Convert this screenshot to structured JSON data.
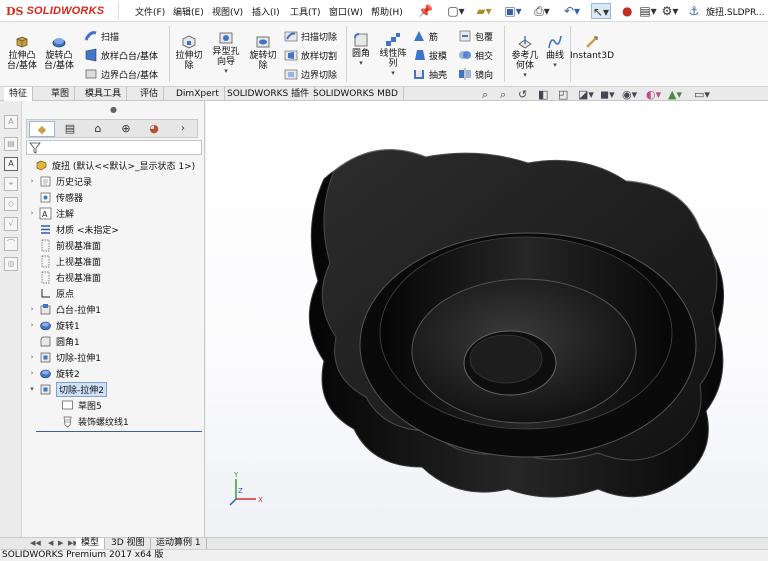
{
  "app": {
    "logo_ds": "DS",
    "logo_brand": "SOLIDWORKS"
  },
  "menu": [
    "文件(F)",
    "编辑(E)",
    "视图(V)",
    "插入(I)",
    "工具(T)",
    "窗口(W)",
    "帮助(H)"
  ],
  "document_title": "旋扭.SLDPR...",
  "command_manager": {
    "buttons": {
      "extrude_boss": "拉伸凸\n台/基体",
      "revolve_boss": "旋转凸\n台/基体",
      "sweep": "扫描",
      "loft_boss": "放样凸台/基体",
      "boundary_boss": "边界凸台/基体",
      "extrude_cut": "拉伸切\n除",
      "hole_wizard": "异型孔\n向导",
      "revolve_cut": "旋转切\n除",
      "sweep_cut": "扫描切除",
      "loft_cut": "放样切割",
      "boundary_cut": "边界切除",
      "fillet": "圆角",
      "linear_pattern": "线性阵\n列",
      "rib": "筋",
      "draft": "拔模",
      "shell": "抽壳",
      "wrap": "包覆",
      "intersect": "相交",
      "mirror": "镜向",
      "ref_geometry": "参考几\n何体",
      "curves": "曲线",
      "instant3d": "Instant3D"
    },
    "tabs": [
      "特征",
      "草图",
      "模具工具",
      "评估",
      "DimXpert",
      "SOLIDWORKS 插件",
      "SOLIDWORKS MBD"
    ],
    "active_tab": "特征"
  },
  "feature_tree": {
    "root": "旋扭 (默认<<默认>_显示状态 1>)",
    "items": [
      {
        "label": "历史记录",
        "icon": "history-icon",
        "expandable": true
      },
      {
        "label": "传感器",
        "icon": "sensor-icon",
        "expandable": false
      },
      {
        "label": "注解",
        "icon": "annotation-icon",
        "expandable": true
      },
      {
        "label": "材质 <未指定>",
        "icon": "material-icon",
        "expandable": false
      },
      {
        "label": "前视基准面",
        "icon": "plane-icon",
        "expandable": false
      },
      {
        "label": "上视基准面",
        "icon": "plane-icon",
        "expandable": false
      },
      {
        "label": "右视基准面",
        "icon": "plane-icon",
        "expandable": false
      },
      {
        "label": "原点",
        "icon": "origin-icon",
        "expandable": false
      },
      {
        "label": "凸台-拉伸1",
        "icon": "extrude-icon",
        "expandable": true
      },
      {
        "label": "旋转1",
        "icon": "revolve-icon",
        "expandable": true
      },
      {
        "label": "圆角1",
        "icon": "fillet-icon",
        "expandable": false
      },
      {
        "label": "切除-拉伸1",
        "icon": "cut-extrude-icon",
        "expandable": true
      },
      {
        "label": "旋转2",
        "icon": "revolve-icon",
        "expandable": true
      },
      {
        "label": "切除-拉伸2",
        "icon": "cut-extrude-icon",
        "expandable": true,
        "expanded": true,
        "selected": true
      },
      {
        "label": "草图5",
        "icon": "sketch-icon",
        "expandable": false,
        "child": true
      },
      {
        "label": "装饰螺纹线1",
        "icon": "cosmetic-thread-icon",
        "expandable": false,
        "child": true
      }
    ]
  },
  "triad": {
    "y": "Y",
    "z": "Z",
    "x": "X"
  },
  "bottom_tabs": [
    "模型",
    "3D 视图",
    "运动算例 1"
  ],
  "active_bottom_tab": "模型",
  "status": "SOLIDWORKS Premium 2017 x64 版",
  "colors": {
    "brand_red": "#d9271c",
    "selection_blue": "#cfe0f7",
    "model_black": "#141414"
  }
}
